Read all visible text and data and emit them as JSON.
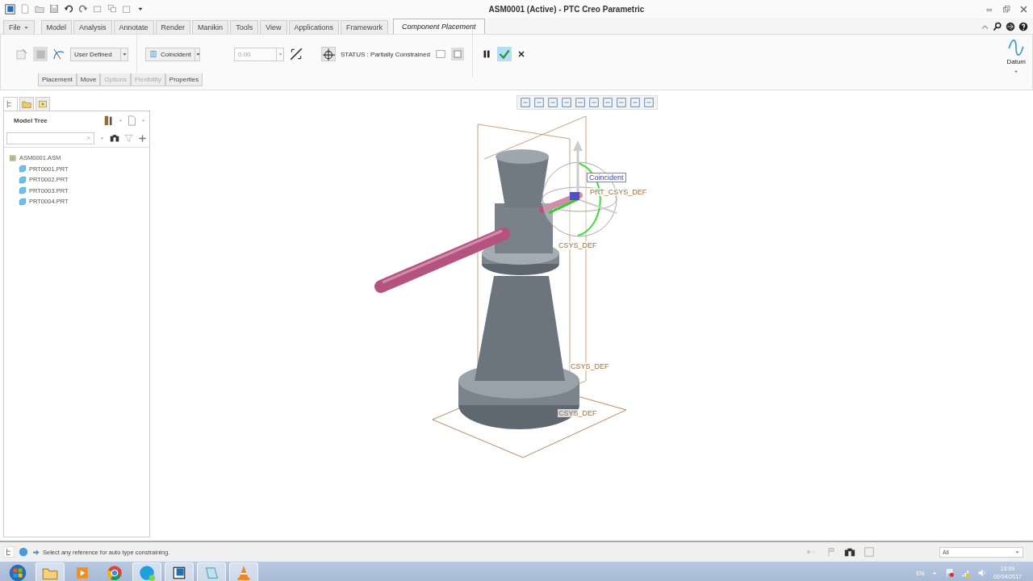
{
  "window": {
    "title": "ASM0001 (Active) - PTC Creo Parametric"
  },
  "file_menu": {
    "label": "File"
  },
  "tabs": [
    {
      "label": "Model",
      "selected": false
    },
    {
      "label": "Analysis",
      "selected": false
    },
    {
      "label": "Annotate",
      "selected": false
    },
    {
      "label": "Render",
      "selected": false
    },
    {
      "label": "Manikin",
      "selected": false
    },
    {
      "label": "Tools",
      "selected": false
    },
    {
      "label": "View",
      "selected": false
    },
    {
      "label": "Applications",
      "selected": false
    },
    {
      "label": "Framework",
      "selected": false
    },
    {
      "label": "Component Placement",
      "selected": true
    }
  ],
  "ribbon": {
    "constraint_set": "User Defined",
    "constraint_type": "Coincident",
    "offset": {
      "value": "0.00",
      "disabled": true
    },
    "status": "STATUS : Partially Constrained",
    "datum": "Datum"
  },
  "sub_tabs": [
    {
      "label": "Placement",
      "disabled": false
    },
    {
      "label": "Move",
      "disabled": false
    },
    {
      "label": "Options",
      "disabled": true
    },
    {
      "label": "Flexibility",
      "disabled": true
    },
    {
      "label": "Properties",
      "disabled": false
    }
  ],
  "model_tree": {
    "title": "Model Tree",
    "items": [
      {
        "label": "ASM0001.ASM",
        "kind": "assembly",
        "children": [
          {
            "label": "PRT0001.PRT",
            "kind": "part"
          },
          {
            "label": "PRT0002.PRT",
            "kind": "part"
          },
          {
            "label": "PRT0003.PRT",
            "kind": "part"
          },
          {
            "label": "PRT0004.PRT",
            "kind": "part"
          }
        ]
      }
    ]
  },
  "viewport": {
    "tooltip": "Coincident",
    "csys_labels": [
      "PRT_CSYS_DEF",
      "CSYS_DEF",
      "CSYS_DEF",
      "CSYS_DEF"
    ]
  },
  "status_bar": {
    "message": "Select any reference for auto type constraining.",
    "filter": "All"
  },
  "taskbar": {
    "language": "EN",
    "time": "13:09",
    "date": "02/04/2017"
  }
}
